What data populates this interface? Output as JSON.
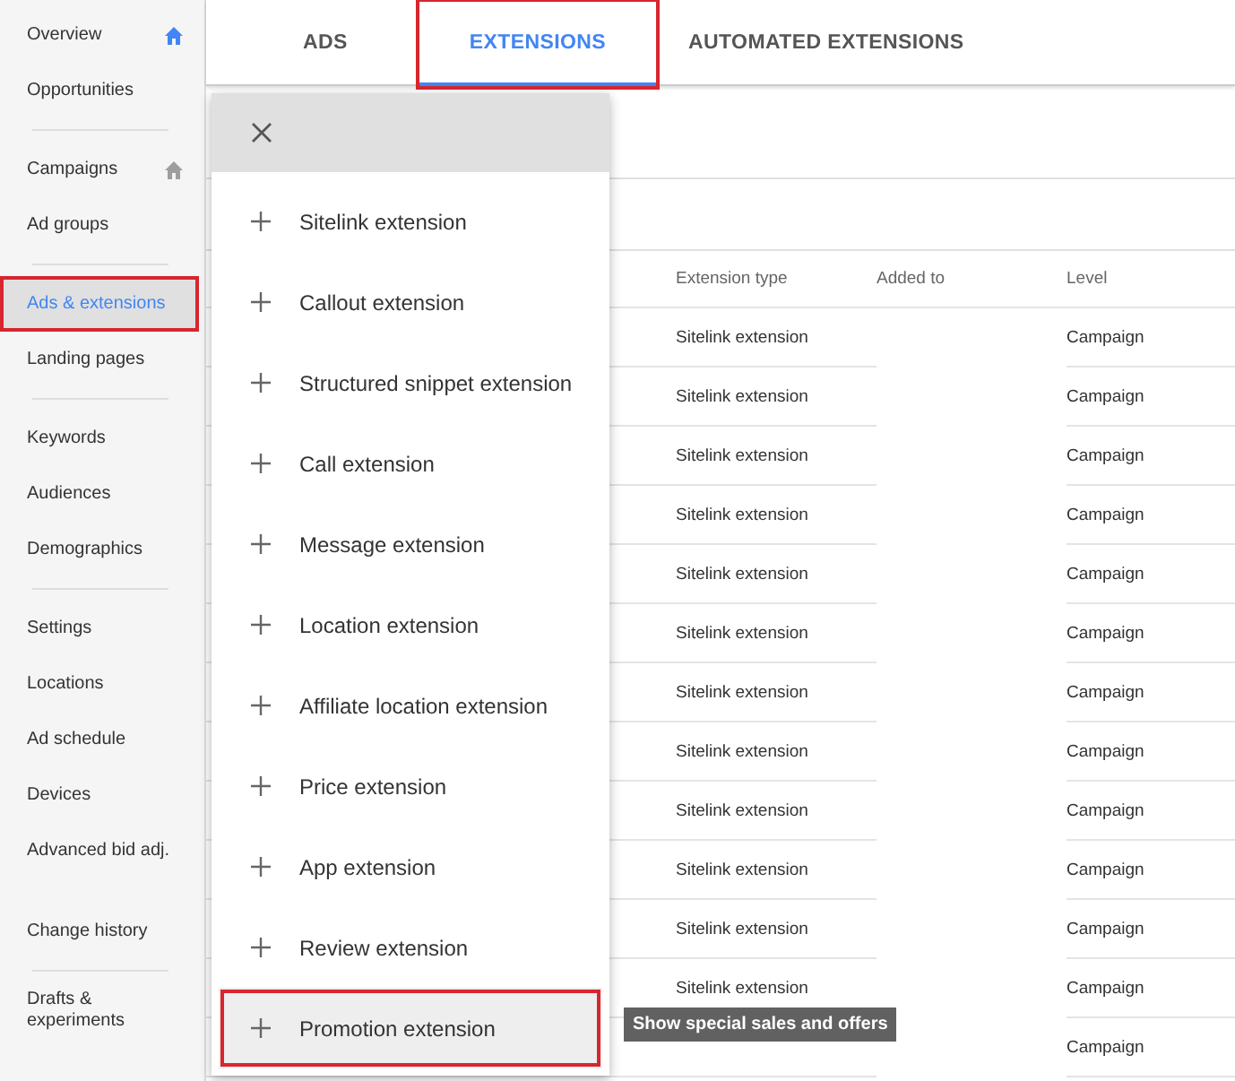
{
  "sidebar": {
    "groups": [
      {
        "divided": true,
        "items": [
          {
            "label": "Overview",
            "selected": false,
            "highlighted": false,
            "home_selected": true
          },
          {
            "label": "Opportunities",
            "selected": false,
            "highlighted": false
          }
        ]
      },
      {
        "divided": true,
        "items": [
          {
            "label": "Campaigns",
            "selected": false,
            "highlighted": false,
            "home_selected": false
          },
          {
            "label": "Ad groups",
            "selected": false,
            "highlighted": false
          }
        ]
      },
      {
        "divided": true,
        "items": [
          {
            "label": "Ads & extensions",
            "selected": true,
            "highlighted": true
          },
          {
            "label": "Landing pages",
            "selected": false,
            "highlighted": false
          }
        ]
      },
      {
        "divided": true,
        "items": [
          {
            "label": "Keywords",
            "selected": false,
            "highlighted": false
          },
          {
            "label": "Audiences",
            "selected": false,
            "highlighted": false
          },
          {
            "label": "Demographics",
            "selected": false,
            "highlighted": false
          }
        ]
      },
      {
        "divided": false,
        "items": [
          {
            "label": "Settings",
            "selected": false,
            "highlighted": false
          },
          {
            "label": "Locations",
            "selected": false,
            "highlighted": false
          },
          {
            "label": "Ad schedule",
            "selected": false,
            "highlighted": false
          },
          {
            "label": "Devices",
            "selected": false,
            "highlighted": false
          },
          {
            "label": "Advanced bid adj.",
            "selected": false,
            "highlighted": false
          }
        ]
      },
      {
        "divided": true,
        "items": [
          {
            "label": "Change history",
            "selected": false,
            "highlighted": false
          }
        ]
      },
      {
        "divided": false,
        "items": [
          {
            "label": "Drafts & experiments",
            "selected": false,
            "highlighted": false
          }
        ]
      }
    ]
  },
  "tabs": [
    {
      "label": "ADS",
      "selected": false,
      "highlighted": false
    },
    {
      "label": "EXTENSIONS",
      "selected": true,
      "highlighted": true
    },
    {
      "label": "AUTOMATED EXTENSIONS",
      "selected": false,
      "highlighted": false
    }
  ],
  "table": {
    "columns": [
      "Extension type",
      "Added to",
      "Level"
    ],
    "rows": [
      {
        "type": "Sitelink extension",
        "level": "Campaign"
      },
      {
        "type": "Sitelink extension",
        "level": "Campaign"
      },
      {
        "type": "Sitelink extension",
        "level": "Campaign"
      },
      {
        "type": "Sitelink extension",
        "level": "Campaign"
      },
      {
        "type": "Sitelink extension",
        "level": "Campaign"
      },
      {
        "type": "Sitelink extension",
        "level": "Campaign"
      },
      {
        "type": "Sitelink extension",
        "level": "Campaign"
      },
      {
        "type": "Sitelink extension",
        "level": "Campaign"
      },
      {
        "type": "Sitelink extension",
        "level": "Campaign"
      },
      {
        "type": "Sitelink extension",
        "level": "Campaign"
      },
      {
        "type": "Sitelink extension",
        "level": "Campaign"
      },
      {
        "type": "Sitelink extension",
        "level": "Campaign"
      },
      {
        "level": "Campaign"
      }
    ]
  },
  "menu": {
    "items": [
      {
        "label": "Sitelink extension",
        "highlighted": false
      },
      {
        "label": "Callout extension",
        "highlighted": false
      },
      {
        "label": "Structured snippet extension",
        "highlighted": false
      },
      {
        "label": "Call extension",
        "highlighted": false
      },
      {
        "label": "Message extension",
        "highlighted": false
      },
      {
        "label": "Location extension",
        "highlighted": false
      },
      {
        "label": "Affiliate location extension",
        "highlighted": false
      },
      {
        "label": "Price extension",
        "highlighted": false
      },
      {
        "label": "App extension",
        "highlighted": false
      },
      {
        "label": "Review extension",
        "highlighted": false
      },
      {
        "label": "Promotion extension",
        "highlighted": true
      }
    ]
  },
  "tooltip": "Show special sales and offers"
}
